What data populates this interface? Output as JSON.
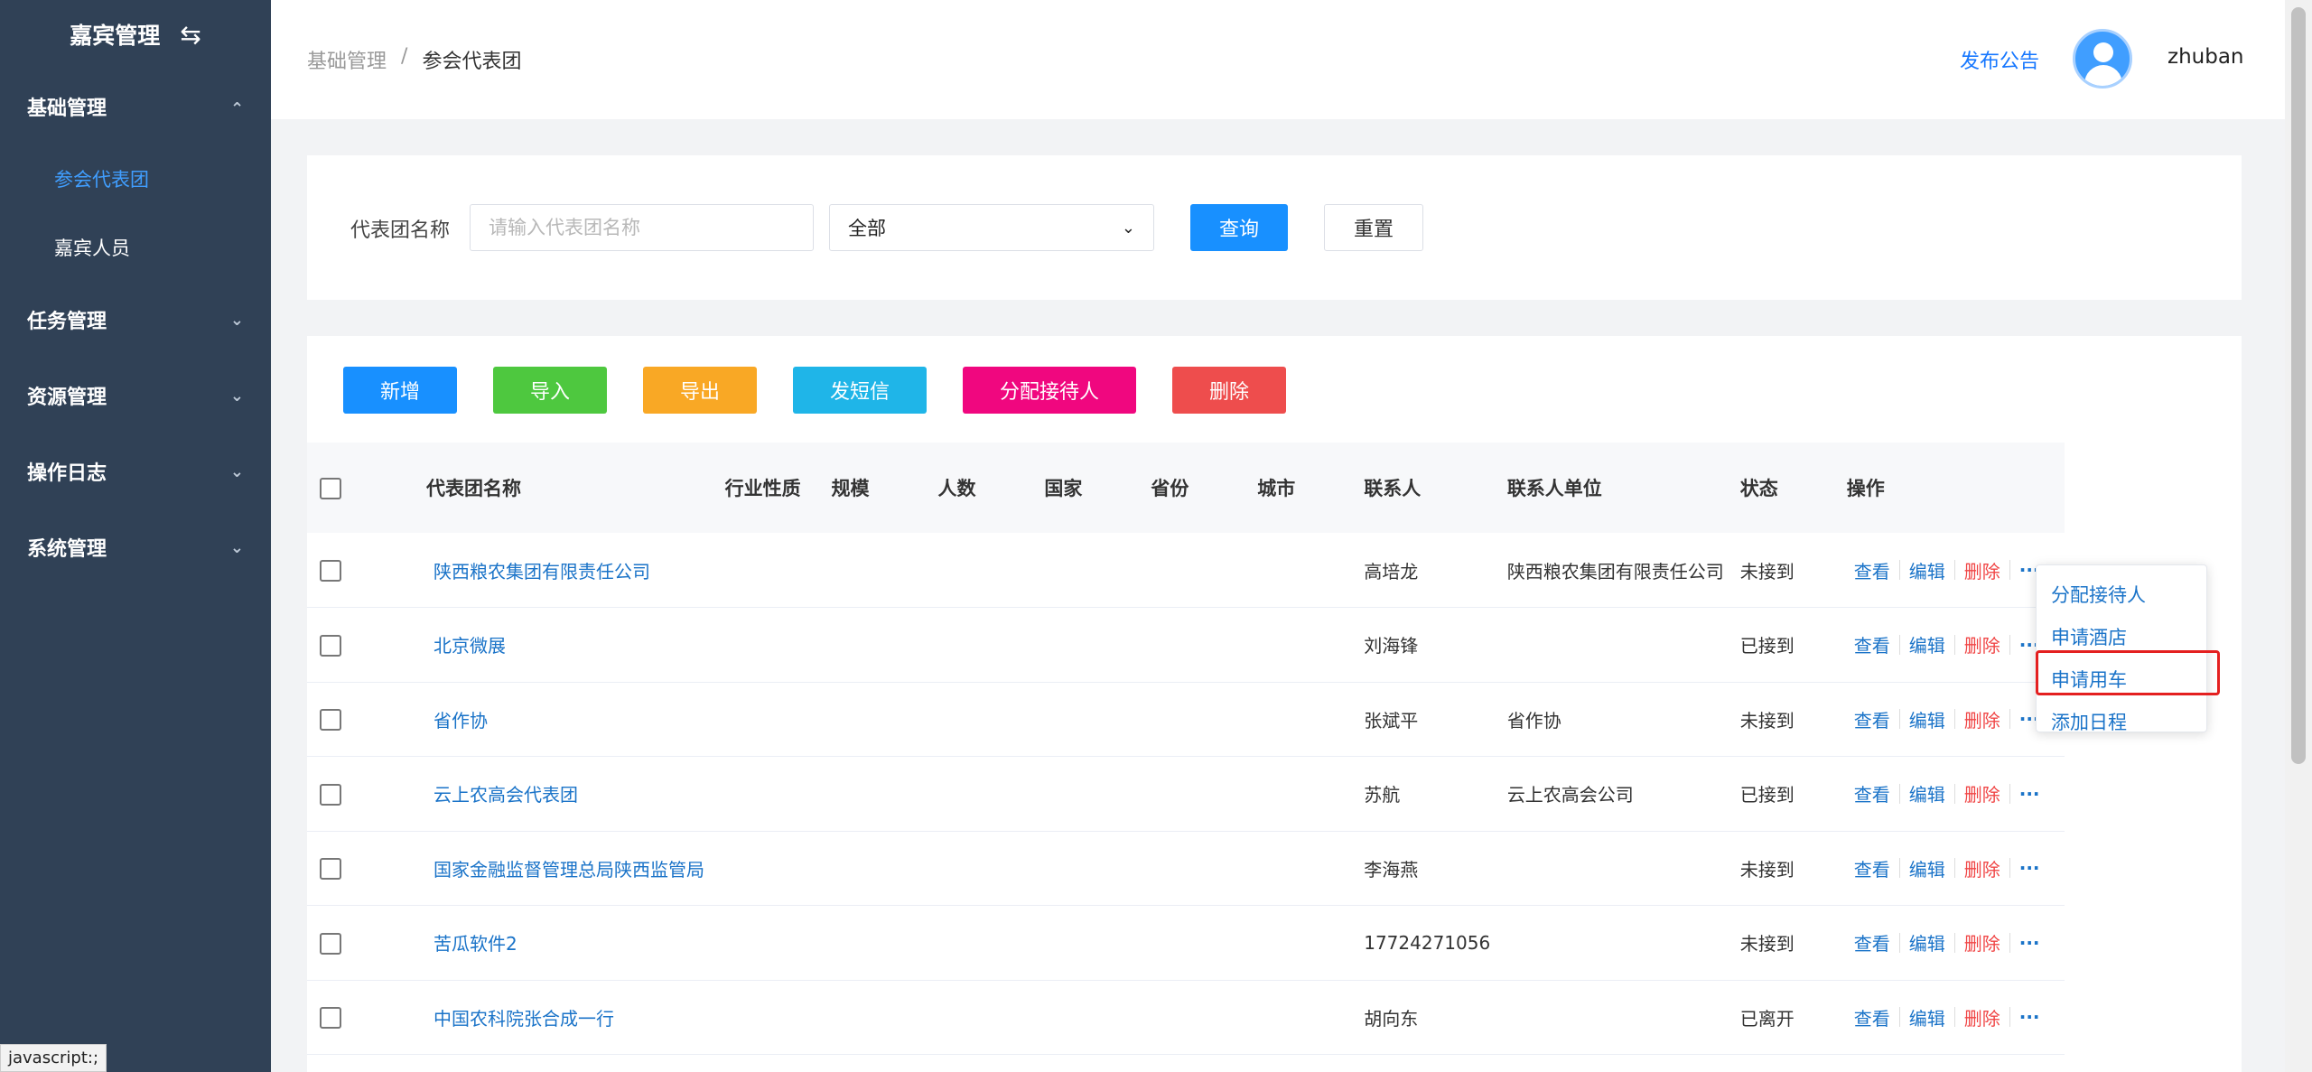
{
  "sidebar": {
    "brand": "嘉宾管理",
    "groups": [
      {
        "label": "基础管理",
        "items": [
          "参会代表团",
          "嘉宾人员"
        ]
      },
      {
        "label": "任务管理"
      },
      {
        "label": "资源管理"
      },
      {
        "label": "操作日志"
      },
      {
        "label": "系统管理"
      }
    ]
  },
  "header": {
    "breadcrumb": [
      "基础管理",
      "/",
      "参会代表团"
    ],
    "publish": "发布公告",
    "username": "zhuban"
  },
  "search": {
    "label": "代表团名称",
    "placeholder": "请输入代表团名称",
    "select_value": "全部",
    "query": "查询",
    "reset": "重置"
  },
  "toolbar": {
    "add": "新增",
    "import": "导入",
    "export": "导出",
    "sms": "发短信",
    "assign": "分配接待人",
    "delete": "删除"
  },
  "table": {
    "headers": [
      "代表团名称",
      "行业性质",
      "规模",
      "人数",
      "国家",
      "省份",
      "城市",
      "联系人",
      "联系人单位",
      "状态",
      "操作"
    ],
    "rows": [
      {
        "name": "陕西粮农集团有限责任公司",
        "contact": "高培龙",
        "unit": "陕西粮农集团有限责任公司",
        "status": "未接到"
      },
      {
        "name": "北京微展",
        "contact": "刘海锋",
        "unit": "",
        "status": "已接到"
      },
      {
        "name": "省作协",
        "contact": "张斌平",
        "unit": "省作协",
        "status": "未接到"
      },
      {
        "name": "云上农高会代表团",
        "contact": "苏航",
        "unit": "云上农高会公司",
        "status": "已接到"
      },
      {
        "name": "国家金融监督管理总局陕西监管局",
        "contact": "李海燕",
        "unit": "",
        "status": "未接到"
      },
      {
        "name": "苦瓜软件2",
        "contact": "17724271056",
        "unit": "",
        "status": "未接到"
      },
      {
        "name": "中国农科院张合成一行",
        "contact": "胡向东",
        "unit": "",
        "status": "已离开"
      }
    ],
    "ops": {
      "view": "查看",
      "edit": "编辑",
      "delete": "删除",
      "more": "···"
    }
  },
  "dropdown": {
    "items": [
      "分配接待人",
      "申请酒店",
      "申请用车",
      "添加日程"
    ]
  },
  "statusbar": "javascript:;"
}
